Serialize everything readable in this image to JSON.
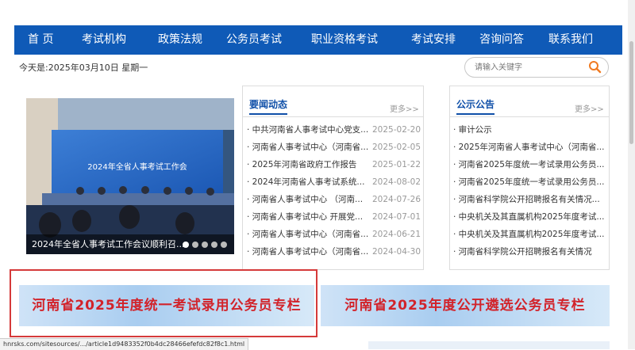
{
  "nav": [
    {
      "label": "首 页"
    },
    {
      "label": "考试机构"
    },
    {
      "label": "政策法规"
    },
    {
      "label": "公务员考试"
    },
    {
      "label": "职业资格考试"
    },
    {
      "label": "考试安排"
    },
    {
      "label": "咨询问答"
    },
    {
      "label": "联系我们"
    }
  ],
  "date_text": "今天是:2025年03月10日 星期一",
  "search": {
    "placeholder": "请输入关键字",
    "icon": "search-icon"
  },
  "slider": {
    "caption": "2024年全省人事考试工作会议顺利召...",
    "screen_text": "2024年全省人事考试工作会",
    "dots": 5
  },
  "news": {
    "title": "要闻动态",
    "more": "更多>>",
    "items": [
      {
        "text": "· 中共河南省人事考试中心党支...",
        "date": "2025-02-20"
      },
      {
        "text": "· 河南省人事考试中心（河南省...",
        "date": "2025-02-05"
      },
      {
        "text": "· 2025年河南省政府工作报告",
        "date": "2025-01-22"
      },
      {
        "text": "· 2024年河南省人事考试系统...",
        "date": "2024-08-02"
      },
      {
        "text": "· 河南省人事考试中心 （河南...",
        "date": "2024-07-26"
      },
      {
        "text": "· 河南省人事考试中心 开展党...",
        "date": "2024-07-01"
      },
      {
        "text": "· 河南省人事考试中心（河南省...",
        "date": "2024-06-21"
      },
      {
        "text": "· 河南省人事考试中心（河南省...",
        "date": "2024-04-30"
      }
    ]
  },
  "notice": {
    "title": "公示公告",
    "more": "更多>>",
    "items": [
      {
        "text": "· 审计公示"
      },
      {
        "text": "· 2025年河南省人事考试中心（河南省..."
      },
      {
        "text": "· 河南省2025年度统一考试录用公务员..."
      },
      {
        "text": "· 河南省2025年度统一考试录用公务员..."
      },
      {
        "text": "· 河南省科学院公开招聘报名有关情况..."
      },
      {
        "text": "· 中央机关及其直属机构2025年度考试..."
      },
      {
        "text": "· 中央机关及其直属机构2025年度考试..."
      },
      {
        "text": "· 河南省科学院公开招聘报名有关情况"
      }
    ]
  },
  "banners": [
    {
      "text": "河南省2025年度统一考试录用公务员专栏"
    },
    {
      "text": "河南省2025年度公开遴选公务员专栏"
    }
  ],
  "status_url": "hnrsks.com/sitesources/.../article1d9483352f0b4dc28466efefdc82f8c1.html",
  "colors": {
    "nav": "#0f5ab7",
    "accent": "#0f4fa8",
    "banner_text": "#d2232a",
    "highlight_box": "#d53a3a"
  }
}
